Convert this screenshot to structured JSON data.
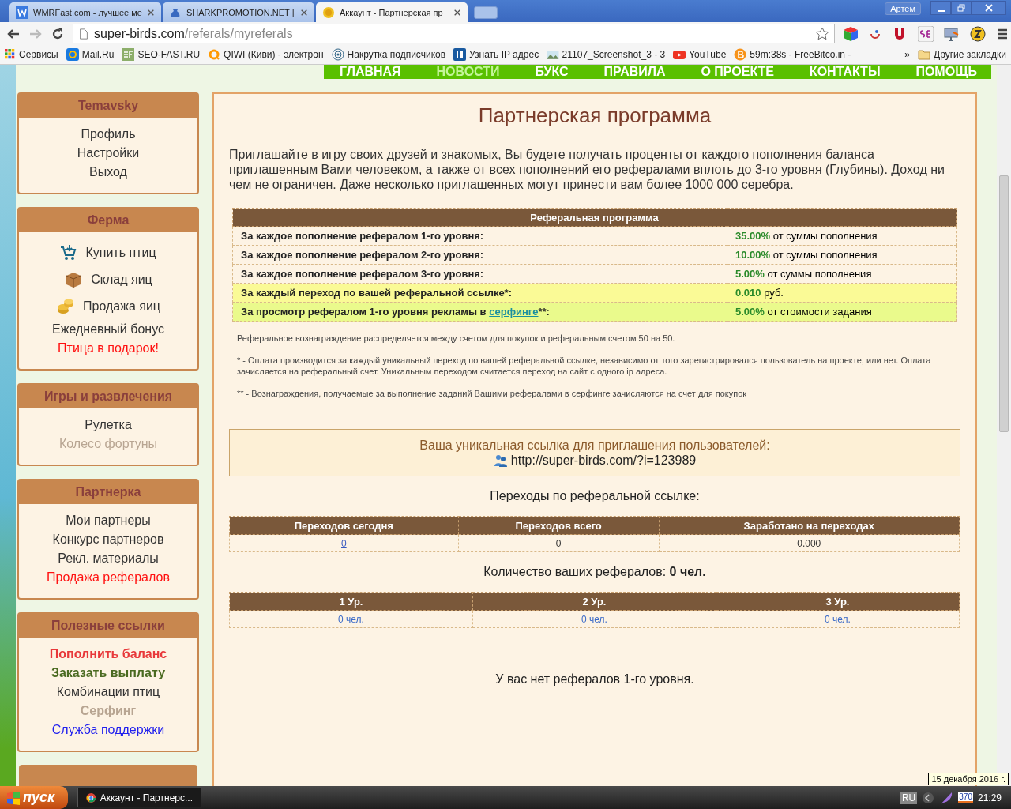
{
  "browser": {
    "tabs": [
      {
        "title": "WMRFast.com - лучшее ме",
        "selected": false
      },
      {
        "title": "SHARKPROMOTION.NET |",
        "selected": false
      },
      {
        "title": "Аккаунт - Партнерская пр",
        "selected": true
      }
    ],
    "user": "Артем",
    "url": {
      "host": "super-birds.com",
      "path": "/referals/myreferals"
    },
    "bookmarks": [
      "Сервисы",
      "Mail.Ru",
      "SEO-FAST.RU",
      "QIWI (Киви) - электрон",
      "Накрутка подписчиков",
      "Узнать IP адрес",
      "21107_Screenshot_3 - 3",
      "YouTube",
      "59m:38s - FreeBitco.in -"
    ],
    "more": "»",
    "other_bookmarks": "Другие закладки"
  },
  "nav": [
    {
      "label": "ГЛАВНАЯ",
      "dimmed": false
    },
    {
      "label": "НОВОСТИ",
      "dimmed": true
    },
    {
      "label": "БУКС",
      "dimmed": false
    },
    {
      "label": "ПРАВИЛА",
      "dimmed": false
    },
    {
      "label": "О ПРОЕКТЕ",
      "dimmed": false
    },
    {
      "label": "КОНТАКТЫ",
      "dimmed": false
    },
    {
      "label": "ПОМОЩЬ",
      "dimmed": false
    }
  ],
  "sidebar": [
    {
      "title": "Temavsky",
      "items": [
        {
          "label": "Профиль",
          "kind": "plain"
        },
        {
          "label": "Настройки",
          "kind": "plain"
        },
        {
          "label": "Выход",
          "kind": "plain"
        }
      ]
    },
    {
      "title": "Ферма",
      "items": [
        {
          "label": "Купить птиц",
          "kind": "icon"
        },
        {
          "label": "Склад яиц",
          "kind": "icon"
        },
        {
          "label": "Продажа яиц",
          "kind": "icon"
        },
        {
          "label": "Ежедневный бонус",
          "kind": "plain"
        },
        {
          "label": "Птица в подарок!",
          "kind": "red"
        }
      ]
    },
    {
      "title": "Игры и развлечения",
      "items": [
        {
          "label": "Рулетка",
          "kind": "plain"
        },
        {
          "label": "Колесо фортуны",
          "kind": "faded"
        }
      ]
    },
    {
      "title": "Партнерка",
      "items": [
        {
          "label": "Мои партнеры",
          "kind": "plain"
        },
        {
          "label": "Конкурс партнеров",
          "kind": "plain"
        },
        {
          "label": "Рекл. материалы",
          "kind": "plain"
        },
        {
          "label": "Продажа рефералов",
          "kind": "red"
        }
      ]
    },
    {
      "title": "Полезные ссылки",
      "items": [
        {
          "label": "Пополнить баланс",
          "kind": "bold-red"
        },
        {
          "label": "Заказать выплату",
          "kind": "bold-green"
        },
        {
          "label": "Комбинации птиц",
          "kind": "plain"
        },
        {
          "label": "Серфинг",
          "kind": "bold-faded"
        },
        {
          "label": "Служба поддержки",
          "kind": "blue"
        }
      ]
    }
  ],
  "main": {
    "title": "Партнерская программа",
    "intro": "Приглашайте в игру своих друзей и знакомых, Вы будете получать проценты от каждого пополнения баланса приглашенным Вами человеком, а также от всех пополнений его рефералами вплоть до 3-го уровня (Глубины). Доход ни чем не ограничен. Даже несколько приглашенных могут принести вам более 1000 000 серебра.",
    "program_table": {
      "heading": "Реферальная программа",
      "rows": [
        {
          "label": "За каждое пополнение рефералом 1-го уровня:",
          "rate": "35.00%",
          "unit": "от суммы пополнения",
          "color": "#fdf3e4"
        },
        {
          "label": "За каждое пополнение рефералом 2-го уровня:",
          "rate": "10.00%",
          "unit": "от суммы пополнения",
          "color": "#fdf3e4"
        },
        {
          "label": "За каждое пополнение рефералом 3-го уровня:",
          "rate": "5.00%",
          "unit": "от суммы пополнения",
          "color": "#fdf3e4"
        },
        {
          "label": "За каждый переход по вашей реферальной ссылке*:",
          "rate": "0.010",
          "unit": "руб.",
          "color": "#fafa96"
        },
        {
          "label": "За просмотр рефералом 1-го уровня рекламы в",
          "link": "серфинге",
          "suffix": "**:",
          "rate": "5.00%",
          "unit": "от стоимости задания",
          "color": "#eafa8c"
        }
      ]
    },
    "notes": [
      "Реферальное вознаграждение распределяется между счетом для покупок и реферальным счетом 50 на 50.",
      "* - Оплата производится за каждый уникальный переход по вашей реферальной ссылке, независимо от того зарегистрировался пользователь на проекте, или нет. Оплата зачисляется на реферальный счет. Уникальным переходом считается переход на сайт с одного ip адреса.",
      "** - Вознаграждения, получаемые за выполнение заданий Вашими рефералами в серфинге зачисляются на счет для покупок"
    ],
    "link_box": {
      "caption": "Ваша уникальная ссылка для приглашения пользователей:",
      "url": "http://super-birds.com/?i=123989"
    },
    "clicks_title": "Переходы по реферальной ссылке:",
    "clicks_table": {
      "columns": [
        "Переходов сегодня",
        "Переходов всего",
        "Заработано на переходах"
      ],
      "cells": [
        {
          "text": "0",
          "link": true
        },
        {
          "text": "0",
          "link": false
        },
        {
          "text": "0.000",
          "link": false
        }
      ]
    },
    "count": "Количество ваших рефералов: **0 чел.**",
    "levels_table": {
      "columns": [
        "1 Ур.",
        "2 Ур.",
        "3 Ур."
      ],
      "cells": [
        "0 чел.",
        "0 чел.",
        "0 чел."
      ]
    },
    "empty_message": "У вас нет рефералов 1-го уровня."
  },
  "taskbar": {
    "start": "пуск",
    "task": "Аккаунт - Партнерс...",
    "lang": "RU",
    "tray_badge": "370",
    "time": "21:29",
    "tooltip": "15 декабря 2016 г."
  }
}
